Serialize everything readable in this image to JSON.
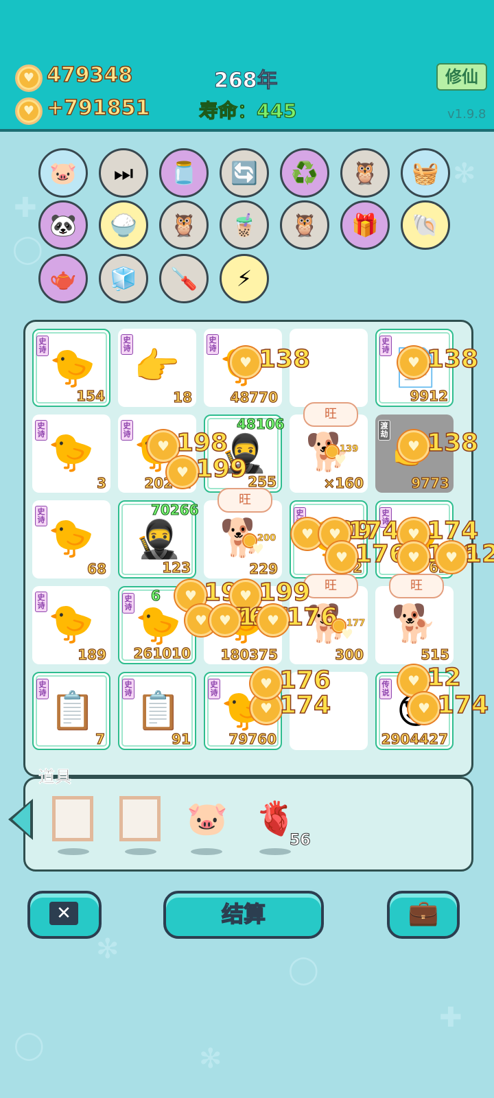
{
  "header": {
    "coins": "479348",
    "income": "+791851",
    "year": "268年",
    "lifespan": "寿命：445",
    "mode_button": "修仙",
    "version": "v1.9.8"
  },
  "relics": [
    {
      "icon": "piggy-bank",
      "glyph": "🐷",
      "bg": "#bde7f5"
    },
    {
      "icon": "skip-sign",
      "glyph": "⏭",
      "bg": "#ddd8cf"
    },
    {
      "icon": "jar",
      "glyph": "🫙",
      "bg": "#d6a6e5"
    },
    {
      "icon": "refresh-arrows",
      "glyph": "🔄",
      "bg": "#ddd8cf"
    },
    {
      "icon": "recycle",
      "glyph": "♻️",
      "bg": "#d6a6e5"
    },
    {
      "icon": "owls",
      "glyph": "🦉",
      "bg": "#ddd8cf"
    },
    {
      "icon": "fruit-basket",
      "glyph": "🧺",
      "bg": "#bde7f5"
    },
    {
      "icon": "panda",
      "glyph": "🐼",
      "bg": "#d6a6e5"
    },
    {
      "icon": "rice-bowl",
      "glyph": "🍚",
      "bg": "#fff3a8"
    },
    {
      "icon": "owls",
      "glyph": "🦉",
      "bg": "#ddd8cf"
    },
    {
      "icon": "bubble-tea",
      "glyph": "🧋",
      "bg": "#ddd8cf"
    },
    {
      "icon": "owls",
      "glyph": "🦉",
      "bg": "#ddd8cf"
    },
    {
      "icon": "pink-box",
      "glyph": "🎁",
      "bg": "#d6a6e5"
    },
    {
      "icon": "shell",
      "glyph": "🐚",
      "bg": "#fff3a8"
    },
    {
      "icon": "gravy-boat",
      "glyph": "🫖",
      "bg": "#d6a6e5"
    },
    {
      "icon": "sugar-cubes",
      "glyph": "🧊",
      "bg": "#ddd8cf"
    },
    {
      "icon": "screwdriver",
      "glyph": "🪛",
      "bg": "#ddd8cf"
    },
    {
      "icon": "lightning",
      "glyph": "⚡",
      "bg": "#fff3a8"
    }
  ],
  "board": {
    "cells": [
      {
        "tag": "史诗",
        "value": "154",
        "glyph": "🐤",
        "rare": true
      },
      {
        "tag": "史诗",
        "value": "18",
        "glyph": "👉"
      },
      {
        "tag": "史诗",
        "value": "48770",
        "glyph": "🐤"
      },
      {
        "tag": "",
        "value": "",
        "glyph": ""
      },
      {
        "tag": "史诗",
        "value": "9912",
        "glyph": "📄",
        "rare": true
      },
      {
        "tag": "史诗",
        "value": "3",
        "glyph": "🐤"
      },
      {
        "tag": "史诗",
        "value": "20244",
        "glyph": "🐤"
      },
      {
        "tag": "",
        "value": "255",
        "glyph": "🥷",
        "top": "48106",
        "rare": true
      },
      {
        "tag": "",
        "value": "×160",
        "glyph": "🐕",
        "bubble": "旺"
      },
      {
        "tag": "渡劫",
        "value": "9773",
        "glyph": "👉",
        "gray": true
      },
      {
        "tag": "史诗",
        "value": "68",
        "glyph": "🐤"
      },
      {
        "tag": "",
        "value": "123",
        "glyph": "🥷",
        "top": "70266",
        "rare": true
      },
      {
        "tag": "",
        "value": "229",
        "glyph": "🐕",
        "bubble": "旺"
      },
      {
        "tag": "史诗",
        "value": "62",
        "glyph": "🐤",
        "rare": true
      },
      {
        "tag": "史诗",
        "value": "62",
        "glyph": "🐤",
        "rare": true
      },
      {
        "tag": "史诗",
        "value": "189",
        "glyph": "🐤"
      },
      {
        "tag": "史诗",
        "value": "261010",
        "glyph": "🐤",
        "top": "6",
        "rare": true
      },
      {
        "tag": "",
        "value": "180375",
        "glyph": "🐤"
      },
      {
        "tag": "",
        "value": "300",
        "glyph": "🐕",
        "bubble": "旺"
      },
      {
        "tag": "",
        "value": "515",
        "glyph": "🐕",
        "bubble": "旺"
      },
      {
        "tag": "史诗",
        "value": "7",
        "glyph": "📋",
        "rare": true
      },
      {
        "tag": "史诗",
        "value": "91",
        "glyph": "📋",
        "rare": true
      },
      {
        "tag": "史诗",
        "value": "79760",
        "glyph": "🐤",
        "rare": true
      },
      {
        "tag": "",
        "value": "",
        "glyph": ""
      },
      {
        "tag": "传说",
        "value": "2904427",
        "glyph": "😎",
        "rare": true
      }
    ],
    "floating_numbers": [
      "138",
      "138",
      "198",
      "199",
      "138",
      "199",
      "174",
      "174",
      "176",
      "176",
      "12",
      "199",
      "199",
      "176",
      "176",
      "176",
      "174",
      "176",
      "12",
      "174",
      "139",
      "200",
      "177"
    ]
  },
  "items": {
    "title": "道具",
    "slots": [
      {
        "icon": "empty-frame"
      },
      {
        "icon": "empty-frame"
      },
      {
        "icon": "piggy-bank",
        "glyph": "🐷"
      },
      {
        "icon": "liver",
        "glyph": "🫀",
        "count": "56"
      }
    ]
  },
  "buttons": {
    "settle": "结算"
  },
  "colors": {
    "header_bg": "#17c2c4",
    "page_bg": "#a9dfe6",
    "accent": "#27c9c7",
    "gold": "#ffd45e"
  }
}
